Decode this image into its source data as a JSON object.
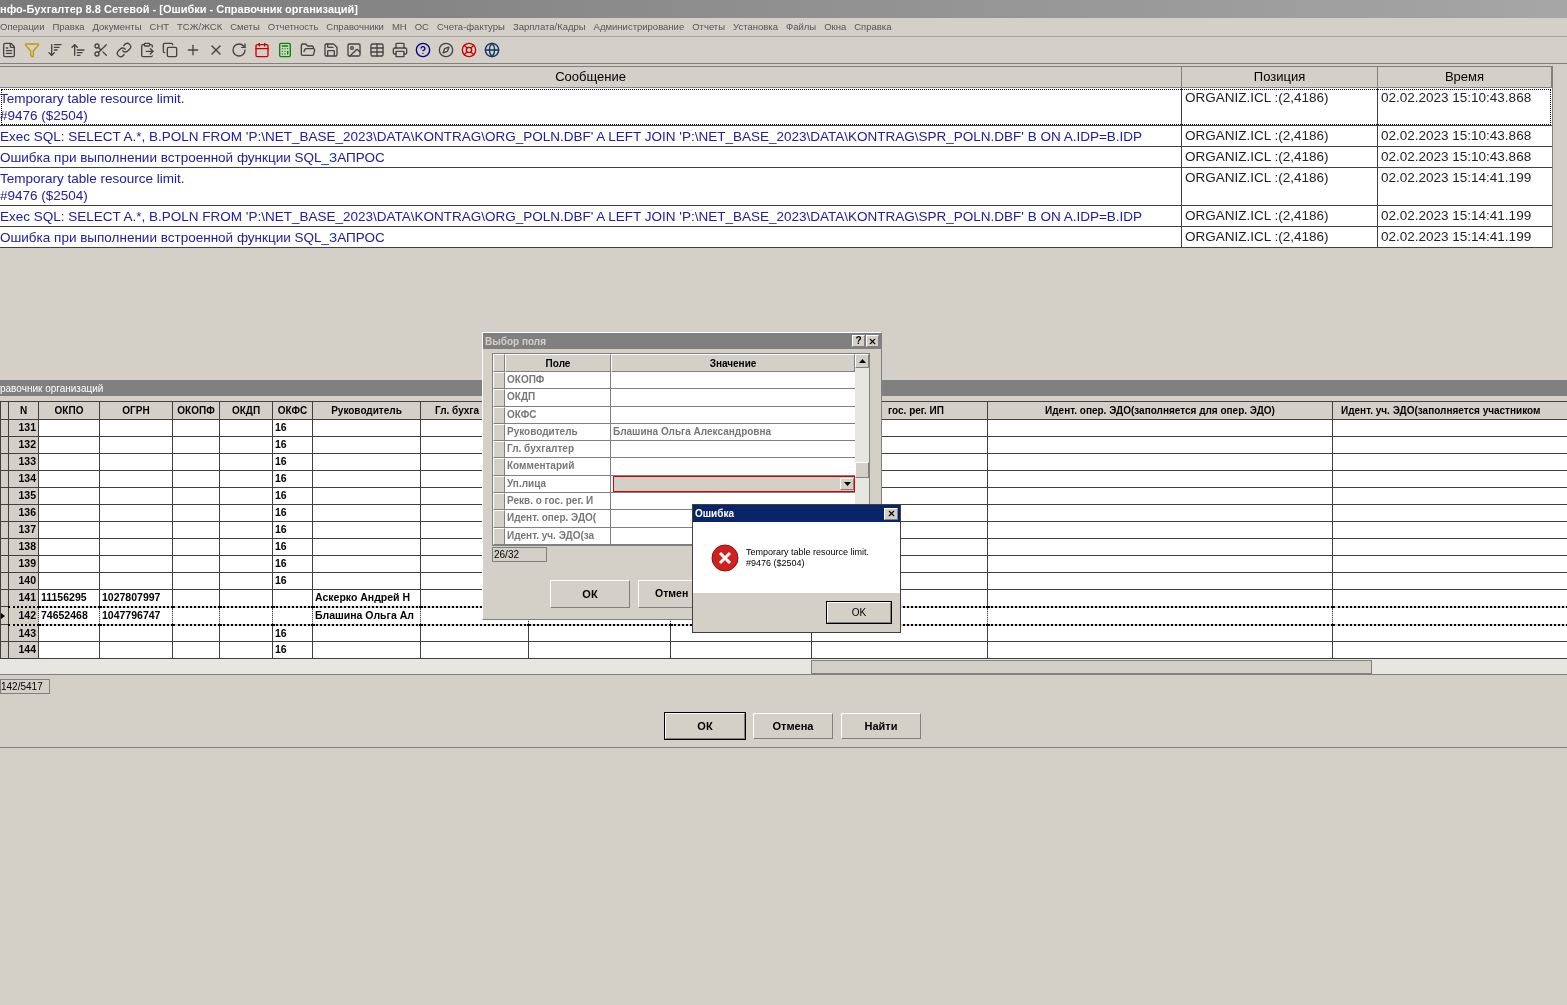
{
  "window": {
    "title": "нфо-Бухгалтер 8.8 Сетевой - [Ошибки - Справочник организаций]"
  },
  "menu": [
    "Операции",
    "Правка",
    "Документы",
    "СНТ",
    "ТСЖ/ЖСК",
    "Сметы",
    "Отчетность",
    "Справочники",
    "МН",
    "ОС",
    "Счета-фактуры",
    "Зарплата/Кадры",
    "Администрирование",
    "Отчеты",
    "Установка",
    "Файлы",
    "Окна",
    "Справка"
  ],
  "log": {
    "columns": [
      "Сообщение",
      "Позиция",
      "Время"
    ],
    "rows": [
      {
        "message": [
          "Temporary table resource limit.",
          "#9476 ($2504)"
        ],
        "position": "ORGANIZ.ICL :(2,4186)",
        "time": "02.02.2023 15:10:43.868",
        "selected": true
      },
      {
        "message": [
          "Exec SQL: SELECT A.*, B.POLN FROM 'P:\\NET_BASE_2023\\DATA\\KONTRAG\\ORG_POLN.DBF' A LEFT JOIN  'P:\\NET_BASE_2023\\DATA\\KONTRAG\\SPR_POLN.DBF' B ON A.IDP=B.IDP"
        ],
        "position": "ORGANIZ.ICL :(2,4186)",
        "time": "02.02.2023 15:10:43.868",
        "selected": false
      },
      {
        "message": [
          "Ошибка при выполнении встроенной функции SQL_ЗАПРОС"
        ],
        "position": "ORGANIZ.ICL :(2,4186)",
        "time": "02.02.2023 15:10:43.868",
        "selected": false
      },
      {
        "message": [
          "Temporary table resource limit.",
          "#9476 ($2504)"
        ],
        "position": "ORGANIZ.ICL :(2,4186)",
        "time": "02.02.2023 15:14:41.199",
        "selected": false
      },
      {
        "message": [
          "Exec SQL: SELECT A.*, B.POLN FROM 'P:\\NET_BASE_2023\\DATA\\KONTRAG\\ORG_POLN.DBF' A LEFT JOIN  'P:\\NET_BASE_2023\\DATA\\KONTRAG\\SPR_POLN.DBF' B ON A.IDP=B.IDP"
        ],
        "position": "ORGANIZ.ICL :(2,4186)",
        "time": "02.02.2023 15:14:41.199",
        "selected": false
      },
      {
        "message": [
          "Ошибка при выполнении встроенной функции SQL_ЗАПРОС"
        ],
        "position": "ORGANIZ.ICL :(2,4186)",
        "time": "02.02.2023 15:14:41.199",
        "selected": false
      }
    ]
  },
  "directory": {
    "title": "равочник организаций",
    "columns": [
      "N",
      "ОКПО",
      "ОГРН",
      "ОКОПФ",
      "ОКДП",
      "ОКФС",
      "Руководитель",
      "Гл. бухга",
      "гос. рег. ИП",
      "Идент. опер. ЭДО(заполняется для опер. ЭДО)",
      "Идент. уч. ЭДО(заполняется участником"
    ],
    "rows": [
      {
        "n": "131",
        "okfs": "16",
        "selected": false
      },
      {
        "n": "132",
        "okfs": "16",
        "selected": false
      },
      {
        "n": "133",
        "okfs": "16",
        "selected": false
      },
      {
        "n": "134",
        "okfs": "16",
        "selected": false
      },
      {
        "n": "135",
        "okfs": "16",
        "selected": false
      },
      {
        "n": "136",
        "okfs": "16",
        "selected": false
      },
      {
        "n": "137",
        "okfs": "16",
        "selected": false
      },
      {
        "n": "138",
        "okfs": "16",
        "selected": false
      },
      {
        "n": "139",
        "okfs": "16",
        "selected": false
      },
      {
        "n": "140",
        "okfs": "16",
        "selected": false
      },
      {
        "n": "141",
        "okpo": "11156295",
        "ogrn": "1027807997",
        "head": "Аскерко Андрей Н",
        "selected": false
      },
      {
        "n": "142",
        "okpo": "74652468",
        "ogrn": "1047796747",
        "head": "Блашина Ольга Ал",
        "selected": true
      },
      {
        "n": "143",
        "okfs": "16",
        "selected": false
      },
      {
        "n": "144",
        "okfs": "16",
        "selected": false
      }
    ],
    "record_counter": "142/5417",
    "buttons": [
      "ОК",
      "Отмена",
      "Найти"
    ]
  },
  "field_dialog": {
    "title": "Выбор поля",
    "help": "?",
    "columns": [
      "Поле",
      "Значение"
    ],
    "rows": [
      {
        "field": "ОКОПФ",
        "kind": "text"
      },
      {
        "field": "ОКДП",
        "kind": "text"
      },
      {
        "field": "ОКФС",
        "kind": "text"
      },
      {
        "field": "Руководитель",
        "value": "Блашина Ольга Александровна",
        "kind": "text"
      },
      {
        "field": "Гл. бухгалтер",
        "kind": "text"
      },
      {
        "field": "Комментарий",
        "kind": "text"
      },
      {
        "field": "Уп.лица",
        "kind": "combo"
      },
      {
        "field": "Рекв. о гос. рег. И",
        "kind": "text"
      },
      {
        "field": "Идент. опер. ЭДО(",
        "kind": "text"
      },
      {
        "field": "Идент. уч. ЭДО(за",
        "kind": "text"
      }
    ],
    "counter": "26/32",
    "buttons": [
      "ОК",
      "Отмен"
    ]
  },
  "error_dialog": {
    "title": "Ошибка",
    "message": [
      "Temporary table resource limit.",
      "#9476 ($2504)"
    ],
    "button": "OK"
  }
}
